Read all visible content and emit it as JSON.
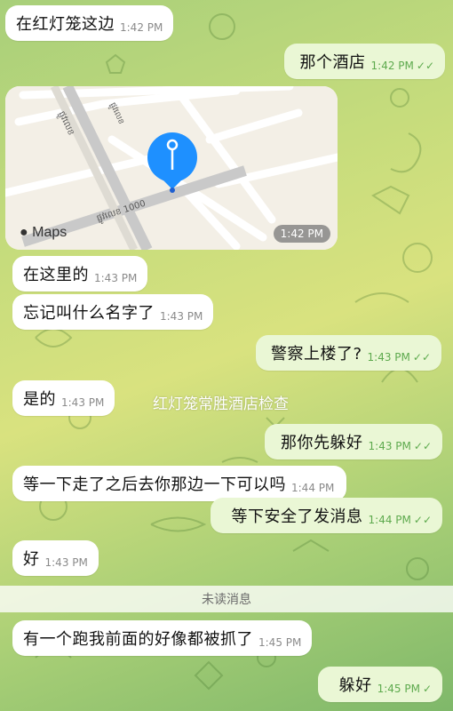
{
  "messages": [
    {
      "text": "在红灯笼这边",
      "time": "1:42 PM"
    },
    {
      "text": "那个酒店",
      "time": "1:42 PM",
      "check": "✓✓"
    },
    {
      "map_logo": "Maps",
      "time": "1:42 PM",
      "street_label": "ផ្លូវលេខ 1000",
      "road_label_1": "ផ្លូវលេខ",
      "road_label_2": "ផ្លូវលេខ"
    },
    {
      "text": "在这里的",
      "time": "1:43 PM"
    },
    {
      "text": "忘记叫什么名字了",
      "time": "1:43 PM"
    },
    {
      "text": "警察上楼了?",
      "time": "1:43 PM",
      "check": "✓✓"
    },
    {
      "text": "是的",
      "time": "1:43 PM"
    },
    {
      "text": "那你先躲好",
      "time": "1:43 PM",
      "check": "✓✓"
    },
    {
      "text": "等一下走了之后去你那边一下可以吗",
      "time": "1:44 PM"
    },
    {
      "text": "等下安全了发消息",
      "time": "1:44 PM",
      "check": "✓✓"
    },
    {
      "text": "好",
      "time": "1:43 PM"
    },
    {
      "text": "有一个跑我前面的好像都被抓了",
      "time": "1:45 PM"
    },
    {
      "text": "躲好",
      "time": "1:45 PM",
      "check": "✓"
    }
  ],
  "overlay_caption": "红灯笼常胜酒店检查",
  "unread_divider": "未读消息",
  "colors": {
    "incoming": "#ffffff",
    "outgoing": "#eaf7d5",
    "check": "#5eaa4e",
    "pin": "#1e90ff"
  }
}
